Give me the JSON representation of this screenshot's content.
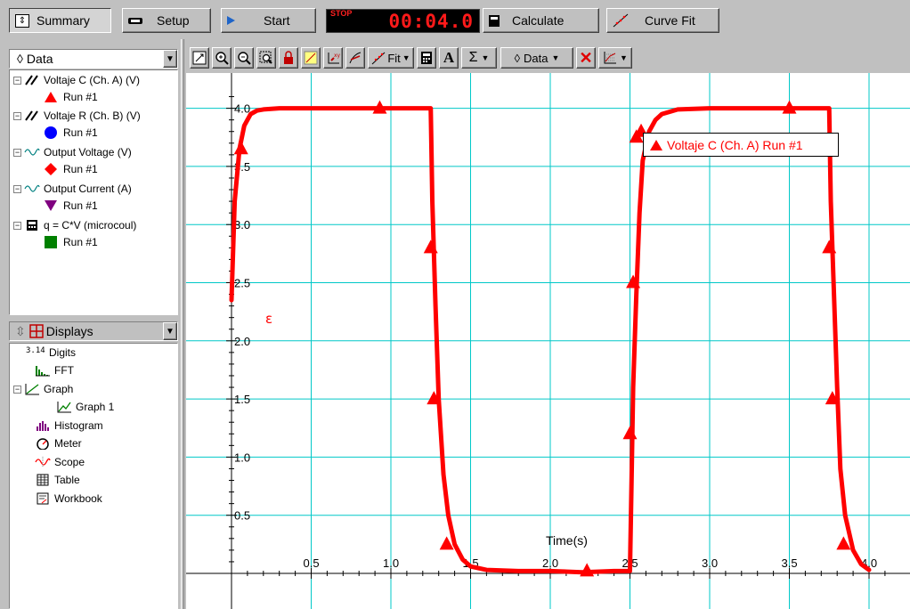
{
  "toolbar": {
    "summary_label": "Summary",
    "setup_label": "Setup",
    "start_label": "Start",
    "stop_label": "STOP",
    "timer": "00:04.0",
    "calculate_label": "Calculate",
    "curvefit_label": "Curve Fit"
  },
  "data_panel": {
    "title": "Data",
    "items": [
      {
        "label": "Voltaje C  (Ch. A) (V)",
        "run": "Run #1",
        "marker": "triangle-up",
        "color": "#ff0000"
      },
      {
        "label": "Voltaje R (Ch. B) (V)",
        "run": "Run #1",
        "marker": "circle",
        "color": "#0000ff"
      },
      {
        "label": "Output Voltage (V)",
        "run": "Run #1",
        "marker": "diamond",
        "color": "#ff0000"
      },
      {
        "label": "Output Current (A)",
        "run": "Run #1",
        "marker": "triangle-down",
        "color": "#800080"
      },
      {
        "label": "q = C*V (microcoul)",
        "run": "Run #1",
        "marker": "square",
        "color": "#008000"
      }
    ]
  },
  "displays_panel": {
    "title": "Displays",
    "items": [
      {
        "label": "Digits",
        "icon": "digits-icon",
        "icon_text": "3.14"
      },
      {
        "label": "FFT",
        "icon": "fft-icon"
      },
      {
        "label": "Graph",
        "icon": "graph-icon"
      },
      {
        "label": "Graph 1",
        "icon": "graph-icon"
      },
      {
        "label": "Histogram",
        "icon": "histogram-icon"
      },
      {
        "label": "Meter",
        "icon": "meter-icon"
      },
      {
        "label": "Scope",
        "icon": "scope-icon"
      },
      {
        "label": "Table",
        "icon": "table-icon"
      },
      {
        "label": "Workbook",
        "icon": "workbook-icon"
      }
    ]
  },
  "graph_toolbar": {
    "fit_label": "Fit",
    "data_label": "Data"
  },
  "graph": {
    "legend_text": "Voltaje C  (Ch. A) Run #1",
    "ylabel_glyph": "ε",
    "accent": "#ff0000",
    "grid_color": "#00c8c8"
  },
  "chart_data": {
    "type": "line",
    "title": "",
    "xlabel": "Time(s)",
    "ylabel": "",
    "xlim": [
      -0.05,
      4.2
    ],
    "ylim": [
      -0.2,
      4.35
    ],
    "x_ticks": [
      "0.5",
      "1.0",
      "1.5",
      "2.0",
      "2.5",
      "3.0",
      "3.5",
      "4.0"
    ],
    "y_ticks": [
      "0.5",
      "1.0",
      "1.5",
      "2.0",
      "2.5",
      "3.0",
      "3.5",
      "4.0"
    ],
    "grid": true,
    "series": [
      {
        "name": "Voltaje C  (Ch. A) Run #1",
        "color": "#ff0000",
        "x": [
          0.0,
          0.02,
          0.05,
          0.08,
          0.12,
          0.16,
          0.2,
          0.3,
          0.5,
          0.8,
          1.0,
          1.2,
          1.25,
          1.26,
          1.28,
          1.3,
          1.33,
          1.36,
          1.4,
          1.45,
          1.5,
          1.6,
          1.8,
          2.0,
          2.2,
          2.4,
          2.5,
          2.51,
          2.52,
          2.54,
          2.56,
          2.58,
          2.62,
          2.66,
          2.7,
          2.8,
          3.0,
          3.3,
          3.5,
          3.7,
          3.75,
          3.76,
          3.78,
          3.8,
          3.82,
          3.85,
          3.9,
          3.95,
          4.0
        ],
        "y": [
          2.35,
          3.2,
          3.65,
          3.85,
          3.95,
          3.98,
          3.99,
          4.0,
          4.0,
          4.0,
          4.0,
          4.0,
          4.0,
          3.2,
          2.3,
          1.5,
          0.85,
          0.5,
          0.25,
          0.12,
          0.06,
          0.03,
          0.02,
          0.02,
          0.01,
          0.02,
          0.02,
          0.8,
          1.6,
          2.4,
          3.1,
          3.55,
          3.8,
          3.9,
          3.95,
          3.99,
          4.0,
          4.0,
          4.0,
          4.0,
          4.0,
          3.2,
          2.4,
          1.6,
          0.9,
          0.5,
          0.2,
          0.08,
          0.03
        ]
      }
    ],
    "markers": {
      "x": [
        0.06,
        0.93,
        1.25,
        1.27,
        1.35,
        2.23,
        2.5,
        2.52,
        2.54,
        2.57,
        3.5,
        3.75,
        3.77,
        3.84
      ],
      "y": [
        3.65,
        4.0,
        2.8,
        1.5,
        0.25,
        0.02,
        1.2,
        2.5,
        3.75,
        3.8,
        4.0,
        2.8,
        1.5,
        0.25
      ]
    }
  }
}
